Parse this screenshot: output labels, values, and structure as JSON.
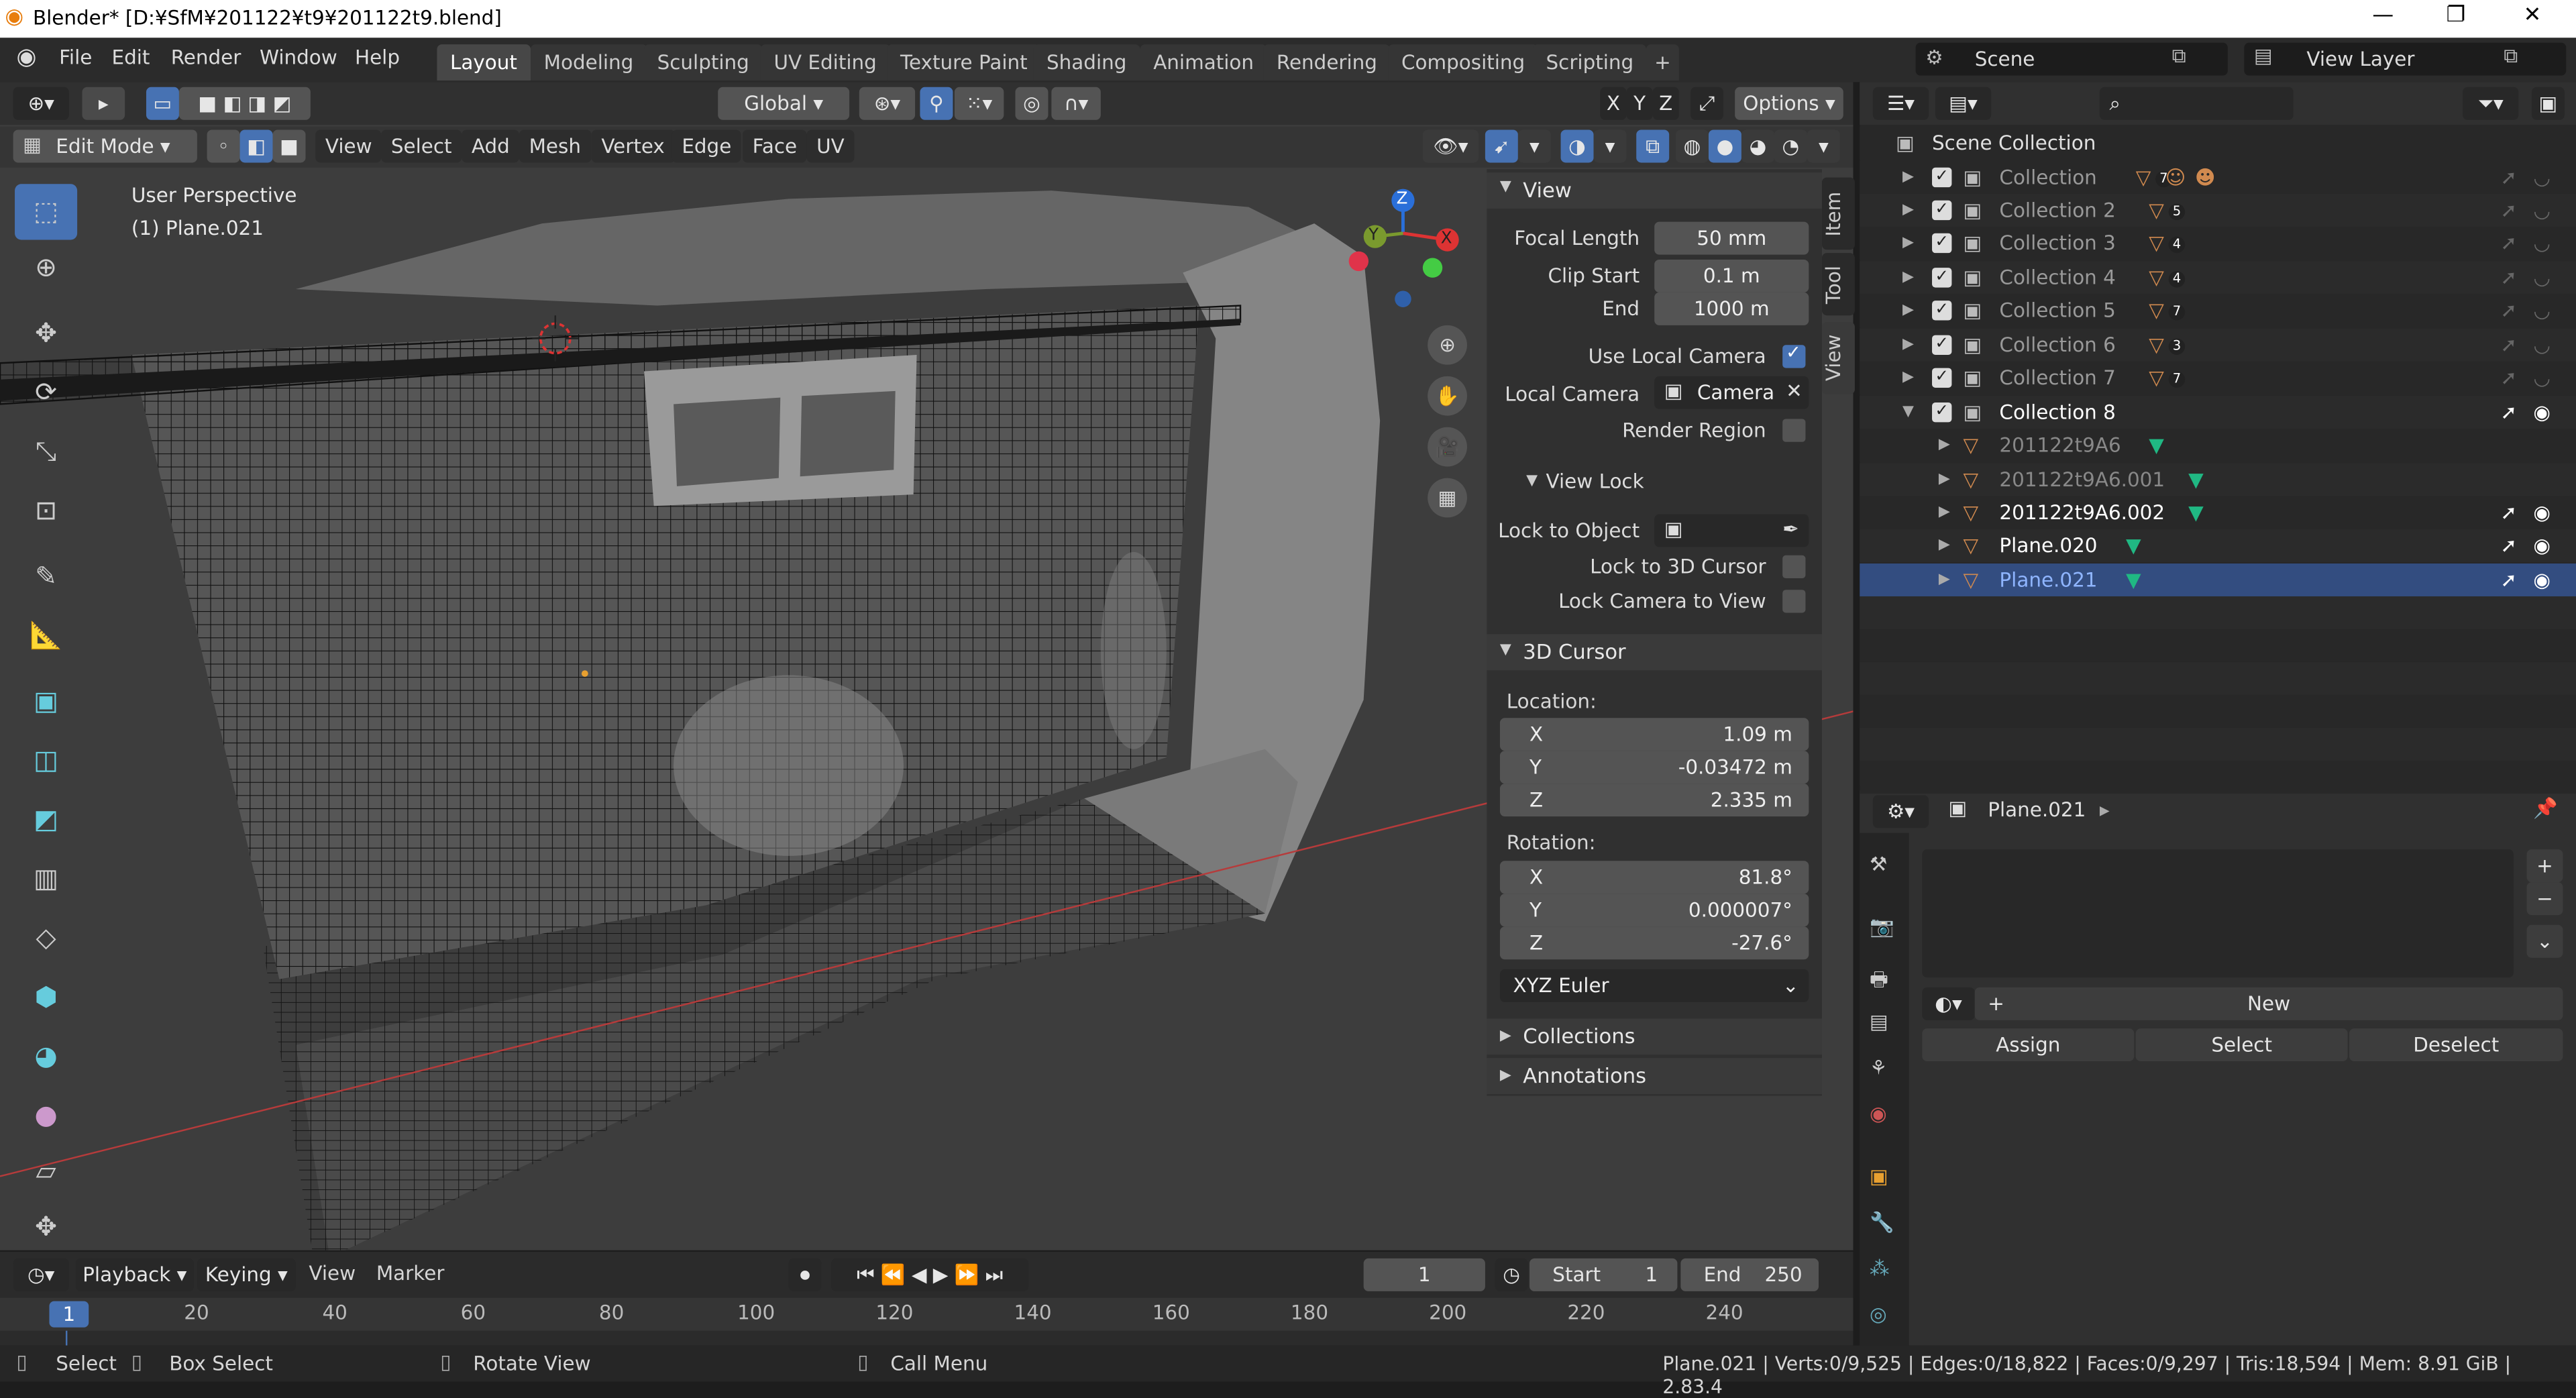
{
  "window": {
    "title": "Blender* [D:¥SfM¥201122¥t9¥201122t9.blend]",
    "minimize": "—",
    "maximize": "❐",
    "close": "✕"
  },
  "menu": {
    "items": [
      "File",
      "Edit",
      "Render",
      "Window",
      "Help"
    ]
  },
  "workspaces": {
    "tabs": [
      "Layout",
      "Modeling",
      "Sculpting",
      "UV Editing",
      "Texture Paint",
      "Shading",
      "Animation",
      "Rendering",
      "Compositing",
      "Scripting"
    ],
    "active": "Layout",
    "add": "+"
  },
  "scene": {
    "label": "Scene",
    "view_layer": "View Layer"
  },
  "viewport_header": {
    "transform_orientation": "Global",
    "options": "Options",
    "axes": [
      "X",
      "Y",
      "Z"
    ]
  },
  "edit_header": {
    "mode": "Edit Mode",
    "menus": [
      "View",
      "Select",
      "Add",
      "Mesh",
      "Vertex",
      "Edge",
      "Face",
      "UV"
    ]
  },
  "viewport": {
    "perspective": "User Perspective",
    "object": "(1) Plane.021",
    "gizmo": {
      "x": "X",
      "y": "Y",
      "z": "Z"
    }
  },
  "npanel": {
    "tabs": [
      "Item",
      "Tool",
      "View"
    ],
    "view": {
      "header": "View",
      "focal_label": "Focal Length",
      "focal": "50 mm",
      "clip_start_label": "Clip Start",
      "clip_start": "0.1 m",
      "end_label": "End",
      "end": "1000 m",
      "use_local_camera": "Use Local Camera",
      "local_camera_label": "Local Camera",
      "local_camera": "Camera",
      "render_region": "Render Region"
    },
    "view_lock": {
      "header": "View Lock",
      "lock_object": "Lock to Object",
      "lock_cursor": "Lock to 3D Cursor",
      "lock_camera": "Lock Camera to View"
    },
    "cursor": {
      "header": "3D Cursor",
      "location": "Location:",
      "loc_x": "1.09 m",
      "loc_y": "-0.03472 m",
      "loc_z": "2.335 m",
      "rotation": "Rotation:",
      "rot_x": "81.8°",
      "rot_y": "0.000007°",
      "rot_z": "-27.6°",
      "mode": "XYZ Euler",
      "x": "X",
      "y": "Y",
      "z": "Z"
    },
    "collections": "Collections",
    "annotations": "Annotations"
  },
  "outliner": {
    "root": "Scene Collection",
    "collections": [
      "Collection",
      "Collection 2",
      "Collection 3",
      "Collection 4",
      "Collection 5",
      "Collection 6",
      "Collection 7",
      "Collection 8"
    ],
    "badges": [
      "7",
      "5",
      "4",
      "4",
      "7",
      "3",
      "7"
    ],
    "objects": [
      "201122t9A6",
      "201122t9A6.001",
      "201122t9A6.002",
      "Plane.020",
      "Plane.021"
    ]
  },
  "properties": {
    "object": "Plane.021",
    "new": "New",
    "assign": "Assign",
    "select": "Select",
    "deselect": "Deselect"
  },
  "timeline": {
    "playback": "Playback",
    "keying": "Keying",
    "view": "View",
    "marker": "Marker",
    "current": "1",
    "start_label": "Start",
    "start": "1",
    "end_label": "End",
    "end": "250",
    "ruler": [
      "20",
      "40",
      "60",
      "80",
      "100",
      "120",
      "140",
      "160",
      "180",
      "200",
      "220",
      "240"
    ],
    "frame_marker": "1"
  },
  "status": {
    "select": "Select",
    "box_select": "Box Select",
    "rotate": "Rotate View",
    "call_menu": "Call Menu",
    "stats": "Plane.021 | Verts:0/9,525 | Edges:0/18,822 | Faces:0/9,297 | Tris:18,594 | Mem: 8.91 GiB | 2.83.4"
  },
  "colors": {
    "accent": "#4772b3",
    "selected_row": "#334d80",
    "object_orange": "#d18a4f",
    "mesh_green": "#20b883"
  }
}
